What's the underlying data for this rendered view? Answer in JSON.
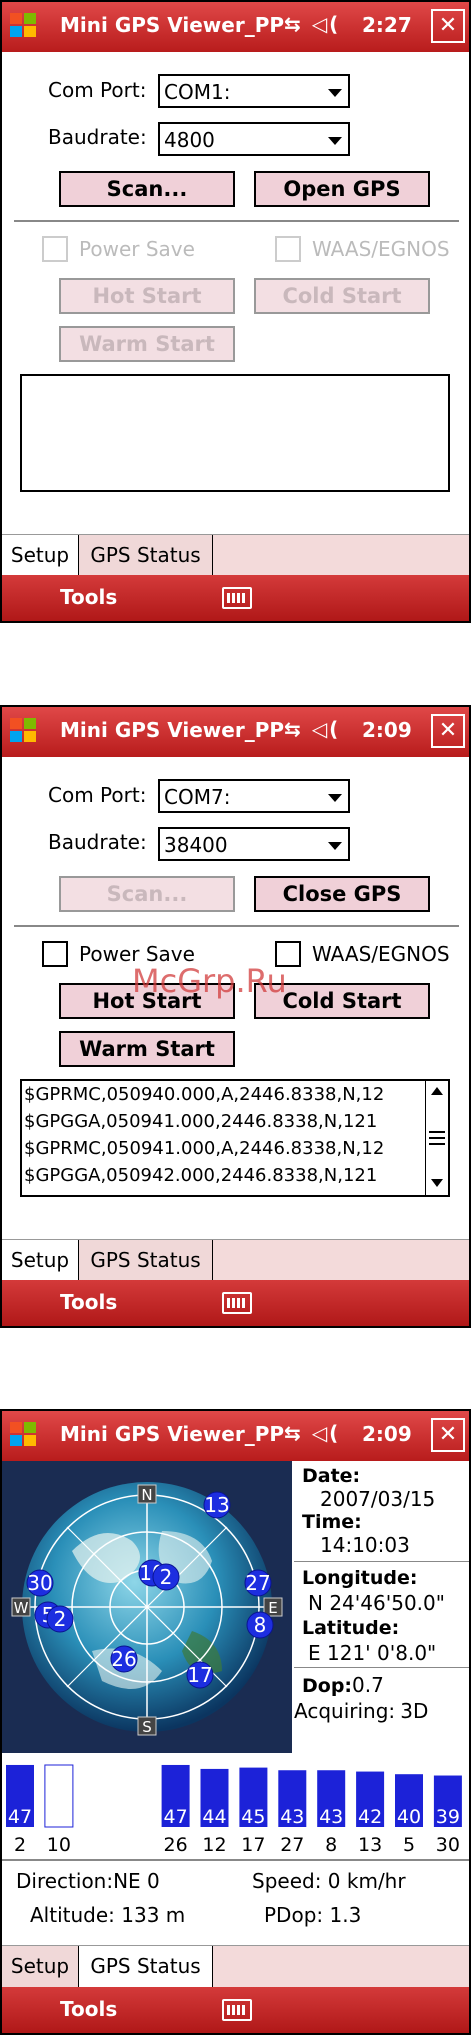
{
  "watermark": "McGrp.Ru",
  "screens": [
    {
      "title": "Mini GPS Viewer_PP",
      "clock": "2:27",
      "com_label": "Com Port:",
      "com_value": "COM1:",
      "baud_label": "Baudrate:",
      "baud_value": "4800",
      "scan_label": "Scan...",
      "open_label": "Open GPS",
      "power_save": "Power Save",
      "waas": "WAAS/EGNOS",
      "hot": "Hot Start",
      "cold": "Cold Start",
      "warm": "Warm Start",
      "tab_setup": "Setup",
      "tab_status": "GPS Status",
      "menu": "Tools"
    },
    {
      "title": "Mini GPS Viewer_PP",
      "clock": "2:09",
      "com_label": "Com Port:",
      "com_value": "COM7:",
      "baud_label": "Baudrate:",
      "baud_value": "38400",
      "scan_label": "Scan...",
      "open_label": "Close GPS",
      "power_save": "Power Save",
      "waas": "WAAS/EGNOS",
      "hot": "Hot Start",
      "cold": "Cold Start",
      "warm": "Warm Start",
      "log": [
        "$GPRMC,050940.000,A,2446.8338,N,12",
        "$GPGGA,050941.000,2446.8338,N,121",
        "$GPRMC,050941.000,A,2446.8338,N,12",
        "$GPGGA,050942.000,2446.8338,N,121"
      ],
      "tab_setup": "Setup",
      "tab_status": "GPS Status",
      "menu": "Tools"
    },
    {
      "title": "Mini GPS Viewer_PP",
      "clock": "2:09",
      "compass": {
        "n": "N",
        "s": "S",
        "e": "E",
        "w": "W"
      },
      "date_label": "Date:",
      "date_value": "2007/03/15",
      "time_label": "Time:",
      "time_value": "14:10:03",
      "lon_label": "Longitude:",
      "lon_value": "N  24'46'50.0\"",
      "lat_label": "Latitude:",
      "lat_value": "E 121' 0'8.0\"",
      "dop_label": "Dop:",
      "dop_value": "0.7",
      "acq_label": "Acquiring:",
      "acq_value": "3D",
      "direction_label": "Direction:",
      "direction_value": "NE 0",
      "speed_label": "Speed:",
      "speed_value": "0 km/hr",
      "altitude_label": "Altitude:",
      "altitude_value": "133 m",
      "pdop_label": "PDop:",
      "pdop_value": "1.3",
      "sky_sats": [
        "13",
        "10",
        "2",
        "30",
        "27",
        "5",
        "2",
        "8",
        "26",
        "17"
      ],
      "snr_bars": [
        {
          "prn": "2",
          "snr": "47"
        },
        {
          "prn": "10",
          "snr": ""
        },
        {
          "prn": "",
          "snr": ""
        },
        {
          "prn": "",
          "snr": ""
        },
        {
          "prn": "26",
          "snr": "47"
        },
        {
          "prn": "12",
          "snr": "44"
        },
        {
          "prn": "17",
          "snr": "45"
        },
        {
          "prn": "27",
          "snr": "43"
        },
        {
          "prn": "8",
          "snr": "43"
        },
        {
          "prn": "13",
          "snr": "42"
        },
        {
          "prn": "5",
          "snr": "40"
        },
        {
          "prn": "30",
          "snr": "39"
        }
      ],
      "tab_setup": "Setup",
      "tab_status": "GPS Status",
      "menu": "Tools"
    }
  ]
}
